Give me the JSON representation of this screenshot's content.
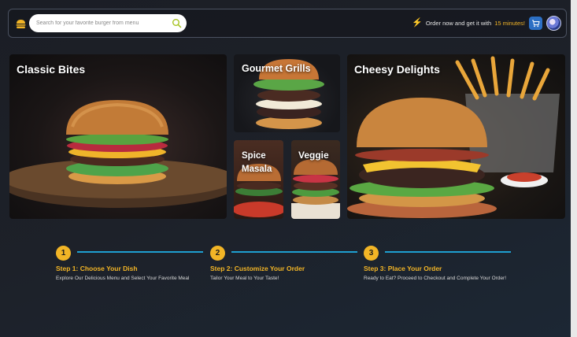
{
  "header": {
    "search_placeholder": "Search for your favorite burger from menu",
    "promo_text": "Order now and get it with",
    "promo_highlight": "15 minutes!",
    "logo_icon": "burger-logo-icon",
    "search_icon": "search-icon",
    "cart_icon": "cart-icon"
  },
  "categories": [
    {
      "title": "Classic Bites"
    },
    {
      "title": "Gourmet Grills"
    },
    {
      "title": "Spice Masala"
    },
    {
      "title": "Veggie"
    },
    {
      "title": "Cheesy Delights"
    }
  ],
  "steps": [
    {
      "number": "1",
      "title": "Step 1: Choose Your Dish",
      "description": "Explore Our Delicious Menu and Select Your Favorite Meal"
    },
    {
      "number": "2",
      "title": "Step 2: Customize Your Order",
      "description": "Tailor Your Meal to Your Taste!"
    },
    {
      "number": "3",
      "title": "Step 3: Place Your Order",
      "description": "Ready to Eat? Proceed to Checkout and Complete Your Order!"
    }
  ],
  "colors": {
    "accent": "#f2b526",
    "line": "#1e9fd0",
    "cart_button": "#2c6fc4"
  }
}
